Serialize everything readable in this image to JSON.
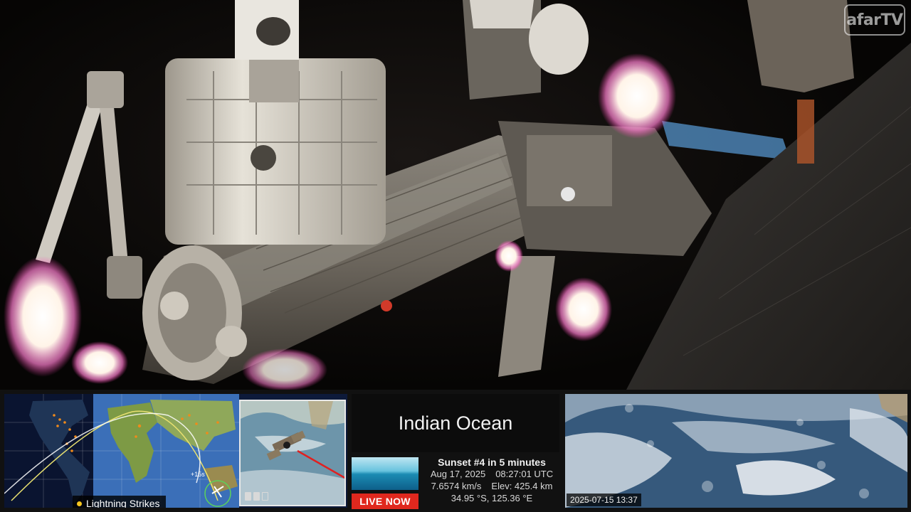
{
  "watermark": "afarTV",
  "tracker": {
    "legend_label": "Lightning Strikes",
    "orbit_label": "+15s",
    "colors": {
      "ocean": "#0d1a3a",
      "day_land": "#6f8f3a",
      "night_land": "#1b2c48",
      "orbit_path": "#e8e070",
      "lightning": "#f08a1a"
    }
  },
  "region": {
    "name": "Indian Ocean"
  },
  "live": {
    "label": "LIVE NOW",
    "color": "#e0281e"
  },
  "stats": {
    "sunset": "Sunset #4 in 5 minutes",
    "date": "Aug 17, 2025",
    "time": "08:27:01 UTC",
    "speed": "7.6574 km/s",
    "elevation": "Elev: 425.4 km",
    "coords": "34.95 °S, 125.36 °E"
  },
  "earth_view": {
    "timestamp": "2025-07-15 13:37"
  }
}
